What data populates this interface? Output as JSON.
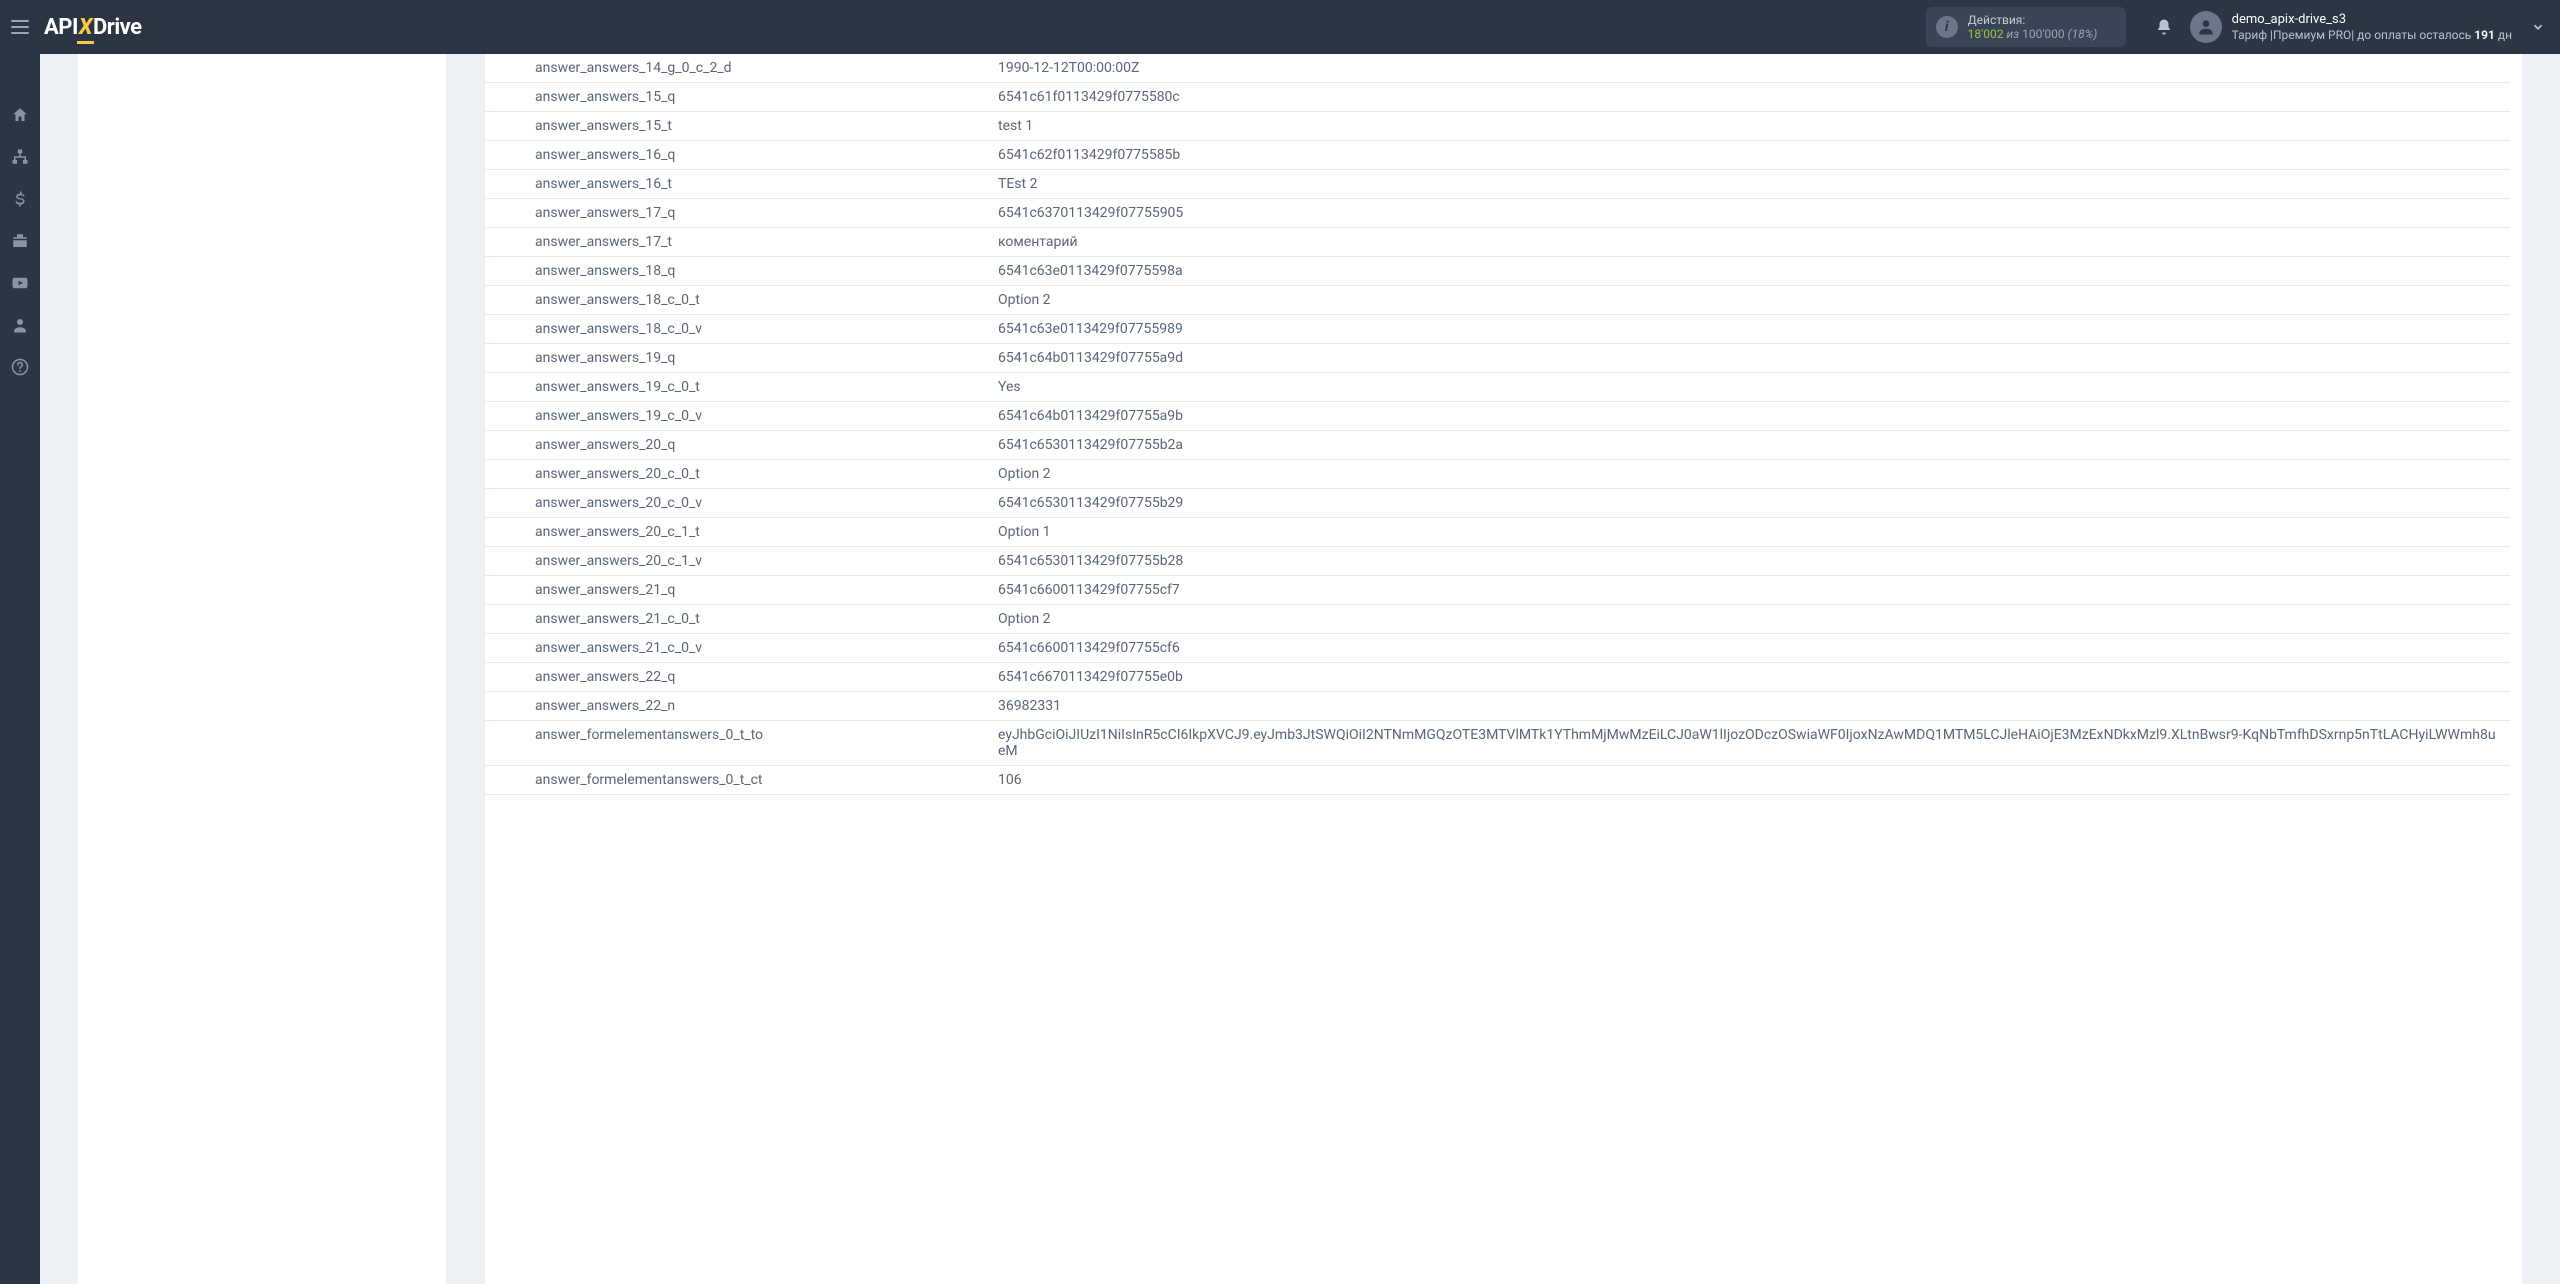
{
  "brand": {
    "api": "API",
    "x": "X",
    "drive": "Drive"
  },
  "actions": {
    "label": "Действия:",
    "count": "18'002",
    "sep": "из",
    "total": "100'000",
    "pct": "(18%)"
  },
  "user": {
    "name": "demo_apix-drive_s3",
    "tariff_prefix": "Тариф |Премиум PRO| до оплаты осталось ",
    "days": "191",
    "days_suffix": " дн"
  },
  "rows": [
    {
      "k": "answer_answers_14_g_0_c_2_d",
      "v": "1990-12-12T00:00:00Z"
    },
    {
      "k": "answer_answers_15_q",
      "v": "6541c61f0113429f0775580c"
    },
    {
      "k": "answer_answers_15_t",
      "v": "test 1"
    },
    {
      "k": "answer_answers_16_q",
      "v": "6541c62f0113429f0775585b"
    },
    {
      "k": "answer_answers_16_t",
      "v": "TEst 2"
    },
    {
      "k": "answer_answers_17_q",
      "v": "6541c6370113429f07755905"
    },
    {
      "k": "answer_answers_17_t",
      "v": "коментарий"
    },
    {
      "k": "answer_answers_18_q",
      "v": "6541c63e0113429f0775598a"
    },
    {
      "k": "answer_answers_18_c_0_t",
      "v": "Option 2"
    },
    {
      "k": "answer_answers_18_c_0_v",
      "v": "6541c63e0113429f07755989"
    },
    {
      "k": "answer_answers_19_q",
      "v": "6541c64b0113429f07755a9d"
    },
    {
      "k": "answer_answers_19_c_0_t",
      "v": "Yes"
    },
    {
      "k": "answer_answers_19_c_0_v",
      "v": "6541c64b0113429f07755a9b"
    },
    {
      "k": "answer_answers_20_q",
      "v": "6541c6530113429f07755b2a"
    },
    {
      "k": "answer_answers_20_c_0_t",
      "v": "Option 2"
    },
    {
      "k": "answer_answers_20_c_0_v",
      "v": "6541c6530113429f07755b29"
    },
    {
      "k": "answer_answers_20_c_1_t",
      "v": "Option 1"
    },
    {
      "k": "answer_answers_20_c_1_v",
      "v": "6541c6530113429f07755b28"
    },
    {
      "k": "answer_answers_21_q",
      "v": "6541c6600113429f07755cf7"
    },
    {
      "k": "answer_answers_21_c_0_t",
      "v": "Option 2"
    },
    {
      "k": "answer_answers_21_c_0_v",
      "v": "6541c6600113429f07755cf6"
    },
    {
      "k": "answer_answers_22_q",
      "v": "6541c6670113429f07755e0b"
    },
    {
      "k": "answer_answers_22_n",
      "v": "36982331"
    },
    {
      "k": "answer_formelementanswers_0_t_to",
      "v": "eyJhbGciOiJIUzI1NiIsInR5cCI6IkpXVCJ9.eyJmb3JtSWQiOiI2NTNmMGQzOTE3MTVlMTk1YThmMjMwMzEiLCJ0aW1lIjozODczOSwiaWF0IjoxNzAwMDQ1MTM5LCJleHAiOjE3MzExNDkxMzl9.XLtnBwsr9-KqNbTmfhDSxrnp5nTtLACHyiLWWmh8ueM"
    },
    {
      "k": "answer_formelementanswers_0_t_ct",
      "v": "106"
    }
  ]
}
